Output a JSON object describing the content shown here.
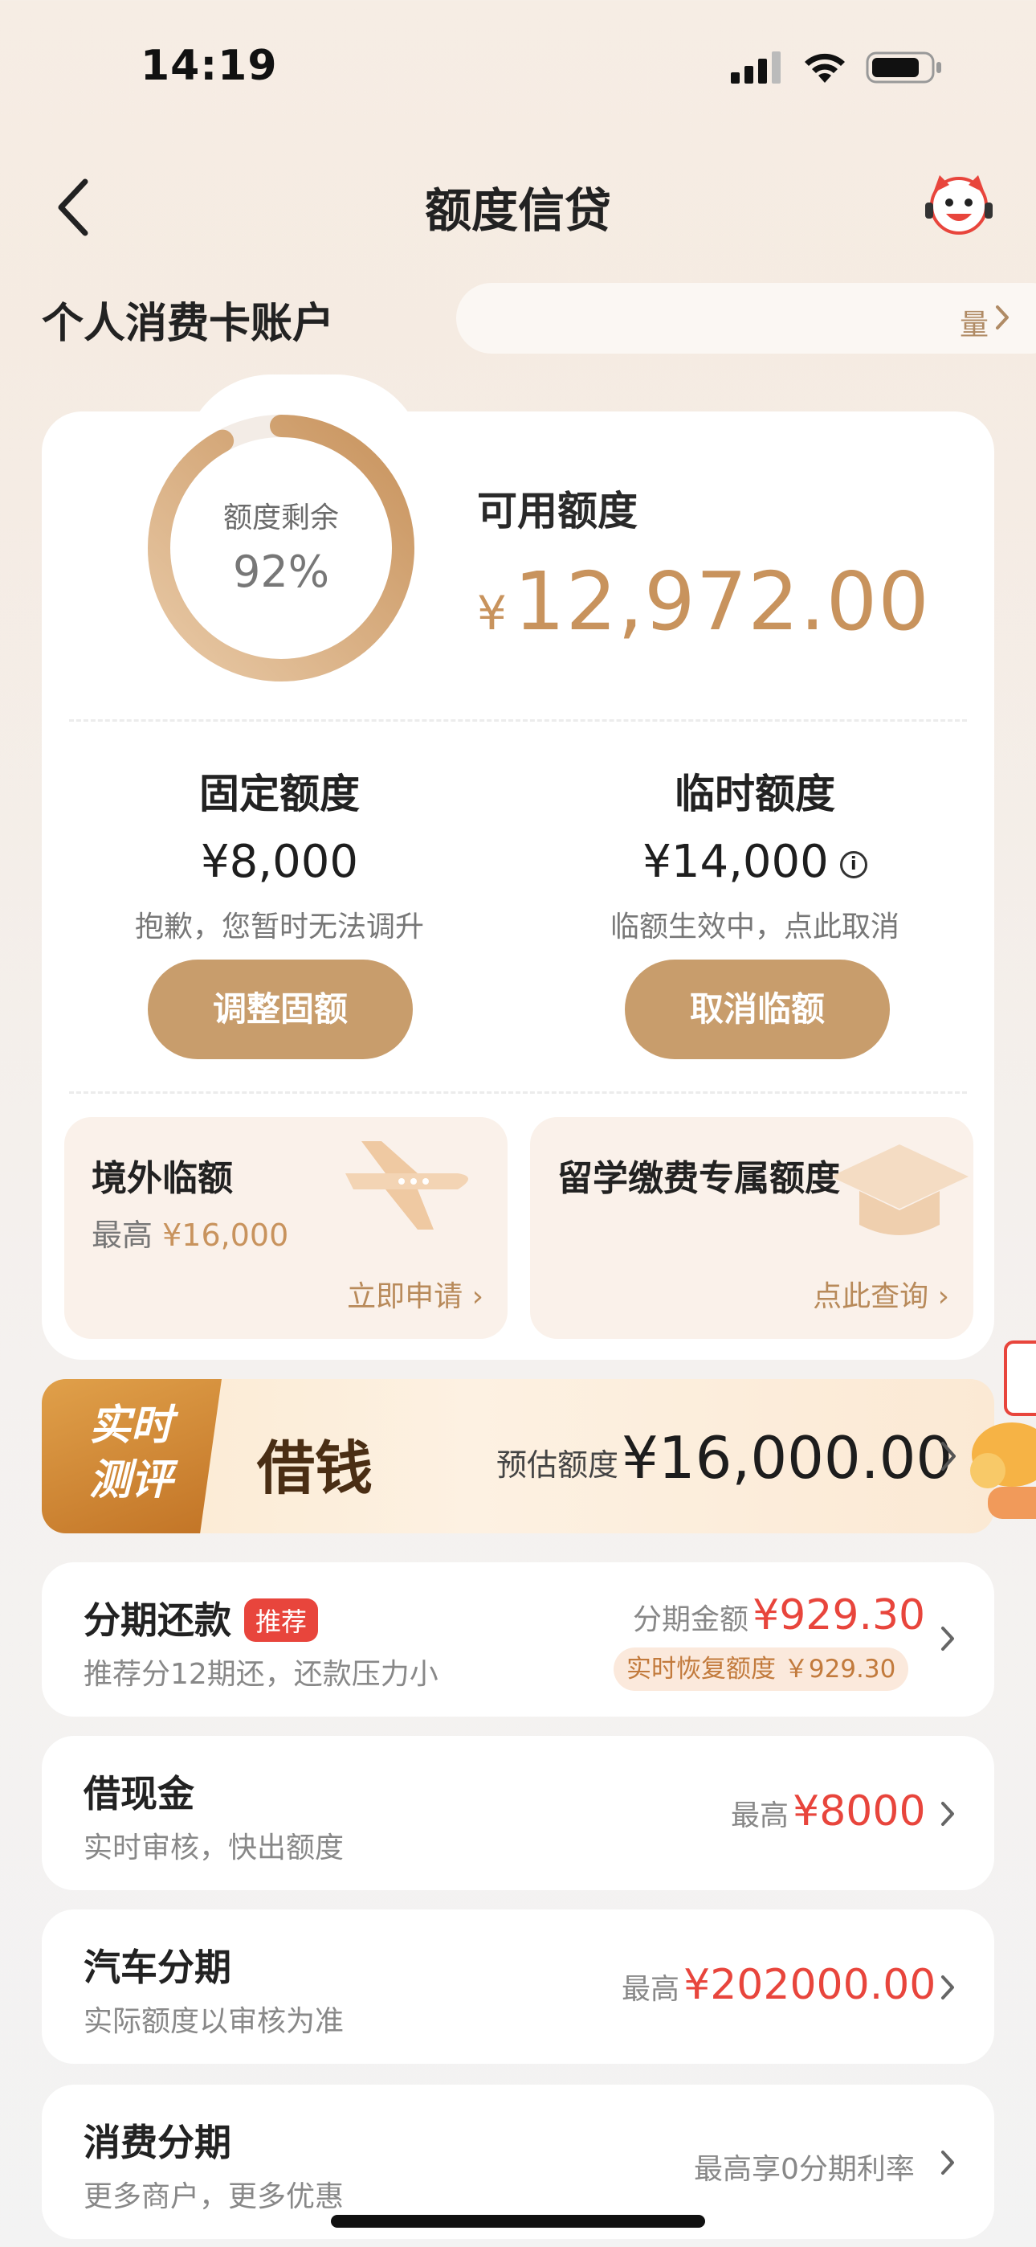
{
  "status": {
    "time": "14:19"
  },
  "nav": {
    "title": "额度信贷"
  },
  "account": {
    "title": "个人消费卡账户",
    "marquee_text": "量"
  },
  "ring": {
    "label": "额度剩余",
    "percent_text": "92%",
    "fraction": 0.92
  },
  "available": {
    "label": "可用额度",
    "currency": "¥",
    "amount": "12,972.00"
  },
  "fixed": {
    "title": "固定额度",
    "amount": "¥8,000",
    "note": "抱歉，您暂时无法调升",
    "button": "调整固额"
  },
  "temp": {
    "title": "临时额度",
    "amount": "¥14,000",
    "info_icon": "i",
    "note": "临额生效中，点此取消",
    "button": "取消临额"
  },
  "promos": [
    {
      "title": "境外临额",
      "sub_prefix": "最高",
      "sub_amount": "¥16,000",
      "link": "立即申请",
      "icon": "airplane-icon"
    },
    {
      "title": "留学缴费专属额度",
      "link": "点此查询",
      "icon": "graduation-cap-icon"
    }
  ],
  "borrow": {
    "tag_line1": "实时",
    "tag_line2": "测评",
    "title": "借钱",
    "est_label": "预估额度",
    "est_amount": "¥16,000.00"
  },
  "installment": {
    "title": "分期还款",
    "badge": "推荐",
    "sub": "推荐分12期还，还款压力小",
    "amount_label": "分期金额",
    "amount": "¥929.30",
    "pill": "实时恢复额度 ￥929.30"
  },
  "cash": {
    "title": "借现金",
    "sub": "实时审核，快出额度",
    "label": "最高",
    "amount": "¥8000"
  },
  "auto": {
    "title": "汽车分期",
    "sub": "实际额度以审核为准",
    "label": "最高",
    "amount": "¥202000.00"
  },
  "consumer": {
    "title": "消费分期",
    "sub": "更多商户，更多优惠",
    "right_text": "最高享0分期利率"
  },
  "colors": {
    "gold": "#c89d6c",
    "gold_text": "#c8935d",
    "red": "#e8453c"
  }
}
